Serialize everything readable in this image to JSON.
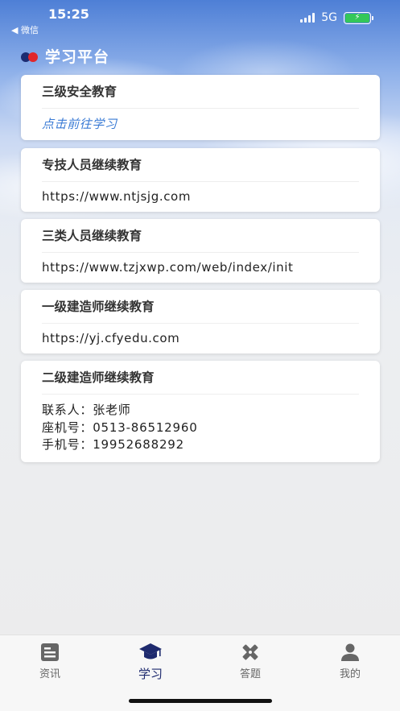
{
  "status_bar": {
    "time": "15:25",
    "back_label": "◀ 微信",
    "network": "5G"
  },
  "header": {
    "title": "学习平台"
  },
  "cards": [
    {
      "title": "三级安全教育",
      "body": "点击前往学习"
    },
    {
      "title": "专技人员继续教育",
      "body": "https://www.ntjsjg.com"
    },
    {
      "title": "三类人员继续教育",
      "body": "https://www.tzjxwp.com/web/index/init"
    },
    {
      "title": "一级建造师继续教育",
      "body": "https://yj.cfyedu.com"
    },
    {
      "title": "二级建造师继续教育",
      "contact": {
        "person": "联系人：张老师",
        "landline": "座机号：0513-86512960",
        "mobile": "手机号：19952688292"
      }
    }
  ],
  "tabbar": {
    "items": [
      {
        "label": "资讯",
        "icon": "document-icon"
      },
      {
        "label": "学习",
        "icon": "graduation-cap-icon"
      },
      {
        "label": "答题",
        "icon": "pencil-ruler-icon"
      },
      {
        "label": "我的",
        "icon": "person-icon"
      }
    ],
    "active_index": 1
  },
  "colors": {
    "accent": "#1e2a6e",
    "link": "#3a7bd5",
    "battery": "#34c759"
  }
}
